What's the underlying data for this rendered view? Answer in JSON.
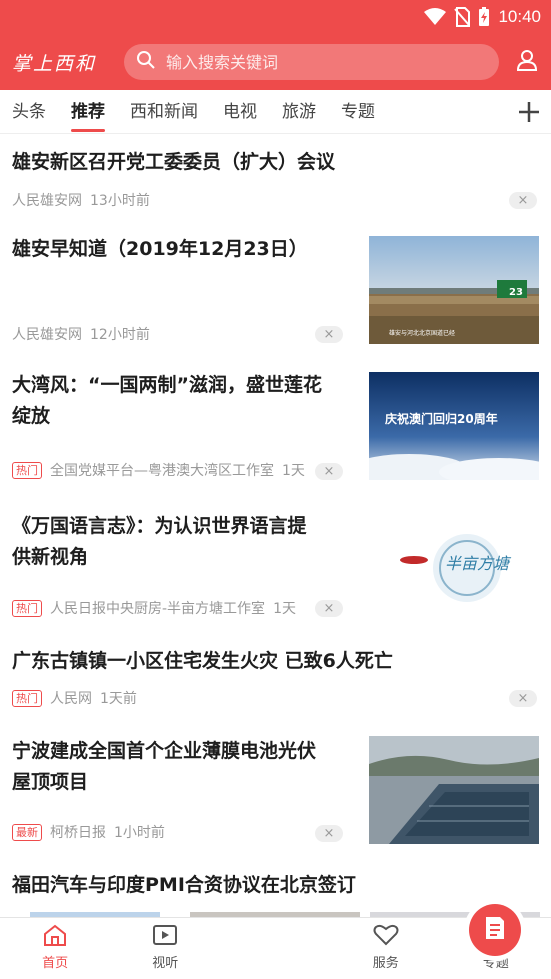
{
  "status": {
    "time": "10:40"
  },
  "header": {
    "logo": "掌上西和",
    "search_placeholder": "输入搜索关键词"
  },
  "tabs": [
    {
      "label": "头条"
    },
    {
      "label": "推荐",
      "active": true
    },
    {
      "label": "西和新闻"
    },
    {
      "label": "电视"
    },
    {
      "label": "旅游"
    },
    {
      "label": "专题"
    }
  ],
  "feed": [
    {
      "title": "雄安新区召开党工委委员（扩大）会议",
      "source": "人民雄安网",
      "time": "13小时前"
    },
    {
      "title": "雄安早知道（2019年12月23日）",
      "source": "人民雄安网",
      "time": "12小时前",
      "thumb_caption": "雄安与河北北京国道已经",
      "sign_number": "23"
    },
    {
      "title_line1": "大湾风：“一国两制”滋润，盛世莲花",
      "title_line2": "绽放",
      "badge": "热门",
      "source": "全国党媒平台—粤港澳大湾区工作室",
      "time": "1天",
      "thumb_text": "庆祝澳门回归20周年"
    },
    {
      "title_line1": "《万国语言志》：为认识世界语言提",
      "title_line2": "供新视角",
      "badge": "热门",
      "source": "人民日报中央厨房-半亩方塘工作室",
      "time": "1天",
      "thumb_text": "半亩方塘"
    },
    {
      "title": "广东古镇镇一小区住宅发生火灾 已致6人死亡",
      "badge": "热门",
      "source": "人民网",
      "time": "1天前"
    },
    {
      "title_line1": "宁波建成全国首个企业薄膜电池光伏",
      "title_line2": "屋顶项目",
      "badge": "最新",
      "source": "柯桥日报",
      "time": "1小时前"
    },
    {
      "title": "福田汽车与印度PMI合资协议在北京签订"
    }
  ],
  "close_glyph": "×",
  "bottom_nav": [
    {
      "label": "首页",
      "icon": "home-icon",
      "active": true
    },
    {
      "label": "视听",
      "icon": "video-icon"
    },
    {
      "label": "",
      "icon": "news-center-icon"
    },
    {
      "label": "服务",
      "icon": "heart-icon"
    },
    {
      "label": "专题",
      "icon": "crown-icon"
    }
  ],
  "colors": {
    "brand": "#ee4b4b",
    "badge": "#ee4b4b"
  }
}
